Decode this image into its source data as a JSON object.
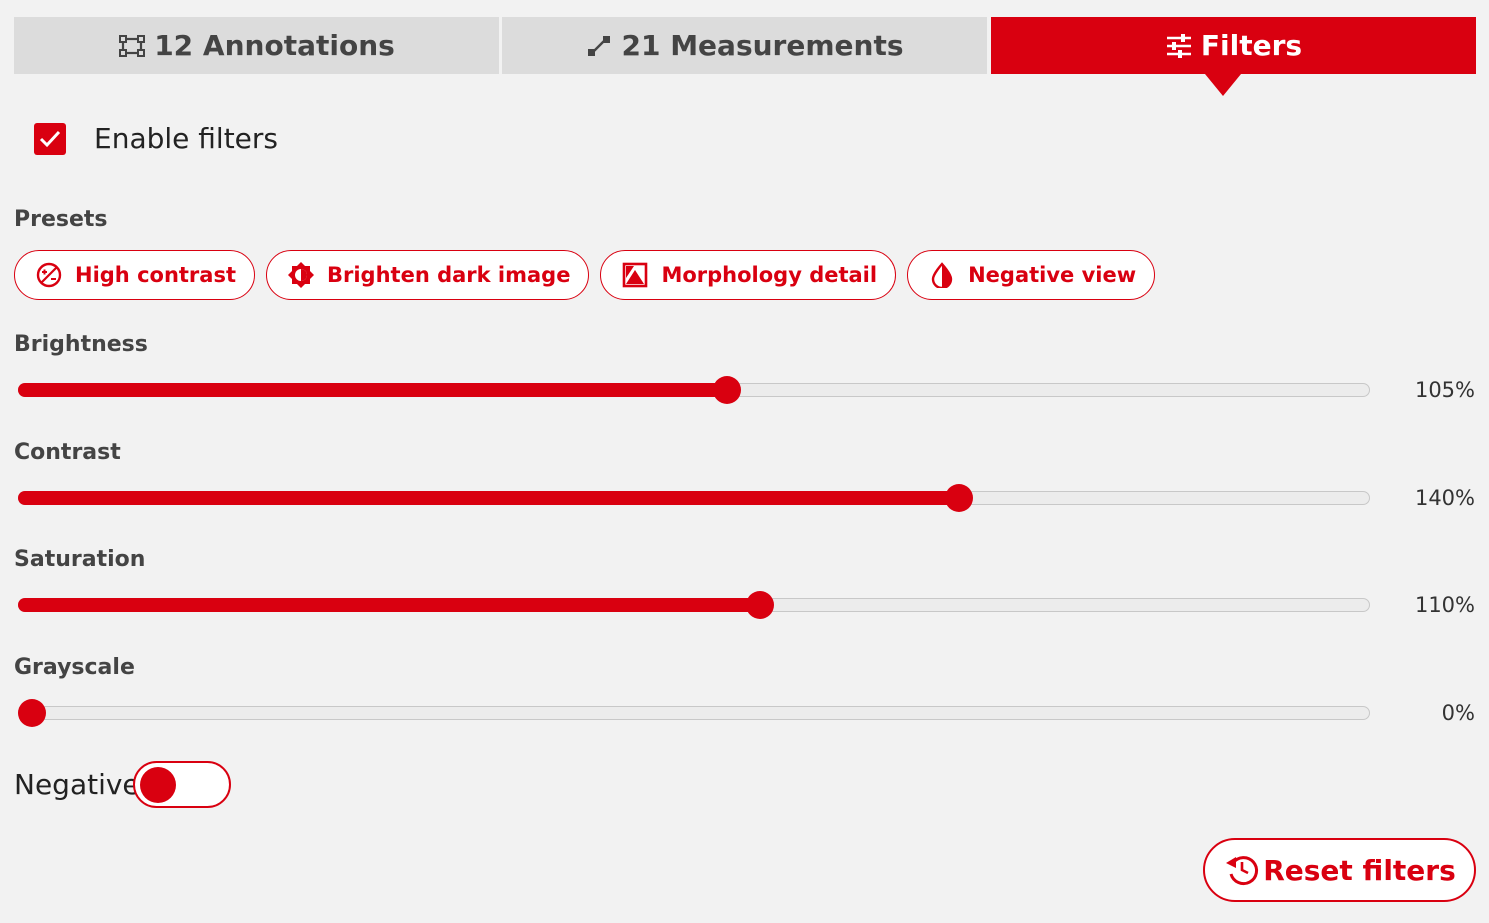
{
  "tabs": {
    "annotations": {
      "label": "12 Annotations",
      "icon": "annotations-icon"
    },
    "measurements": {
      "label": "21 Measurements",
      "icon": "ruler-icon"
    },
    "filters": {
      "label": "Filters",
      "icon": "sliders-icon",
      "active": true
    }
  },
  "enable_filters": {
    "label": "Enable filters",
    "checked": true
  },
  "presets": {
    "title": "Presets",
    "items": [
      {
        "label": "High contrast",
        "icon": "contrast-icon"
      },
      {
        "label": "Brighten dark image",
        "icon": "brightness-icon"
      },
      {
        "label": "Morphology detail",
        "icon": "detail-icon"
      },
      {
        "label": "Negative view",
        "icon": "invert-icon"
      }
    ]
  },
  "sliders": {
    "brightness": {
      "label": "Brightness",
      "value_text": "105%",
      "fraction": 0.525
    },
    "contrast": {
      "label": "Contrast",
      "value_text": "140%",
      "fraction": 0.7
    },
    "saturation": {
      "label": "Saturation",
      "value_text": "110%",
      "fraction": 0.55
    },
    "grayscale": {
      "label": "Grayscale",
      "value_text": "0%",
      "fraction": 0.0
    }
  },
  "negative": {
    "label": "Negative",
    "on": false
  },
  "reset": {
    "label": "Reset filters",
    "icon": "reset-icon"
  },
  "colors": {
    "accent": "#d90010",
    "tab_inactive": "#dcdcdc",
    "background": "#f2f2f2"
  }
}
